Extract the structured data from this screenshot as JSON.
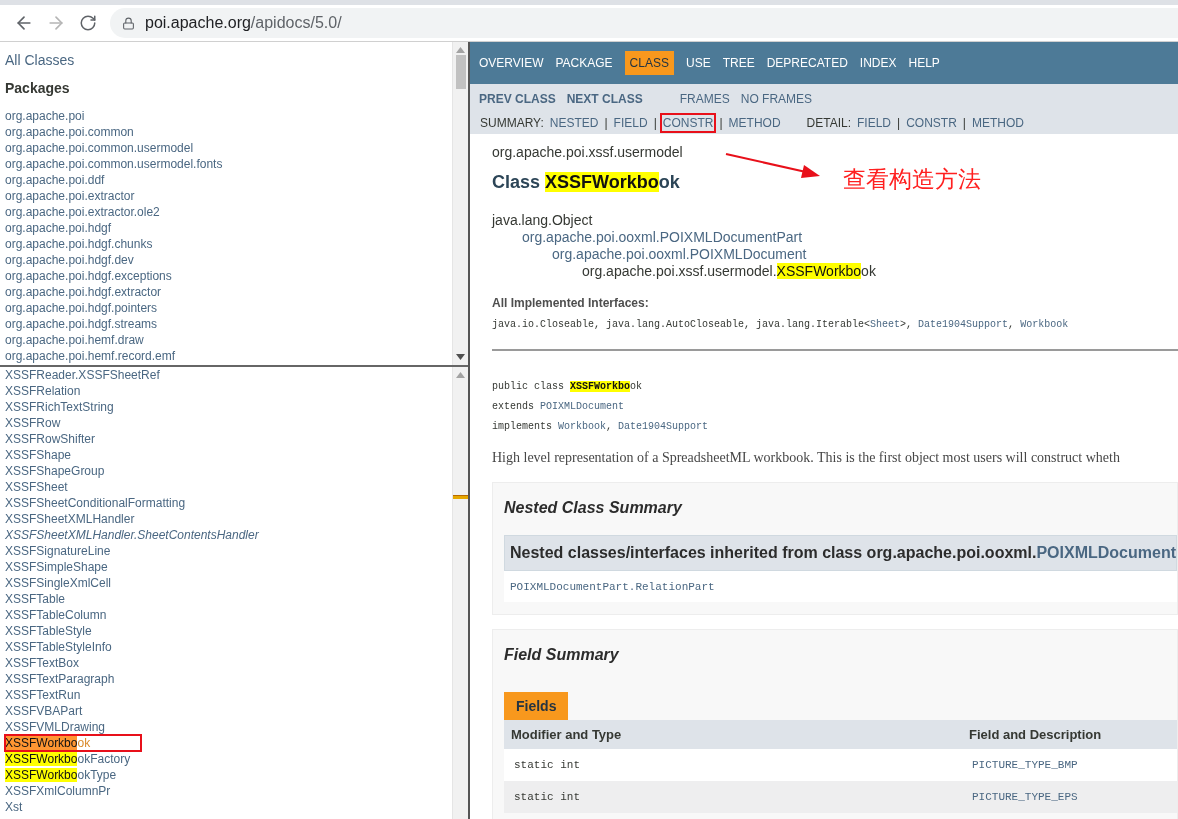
{
  "browser": {
    "url": {
      "host": "poi.apache.org",
      "path": "/apidocs/5.0/"
    }
  },
  "package_frame": {
    "all_classes_link": "All Classes",
    "heading": "Packages",
    "packages": [
      "org.apache.poi",
      "org.apache.poi.common",
      "org.apache.poi.common.usermodel",
      "org.apache.poi.common.usermodel.fonts",
      "org.apache.poi.ddf",
      "org.apache.poi.extractor",
      "org.apache.poi.extractor.ole2",
      "org.apache.poi.hdgf",
      "org.apache.poi.hdgf.chunks",
      "org.apache.poi.hdgf.dev",
      "org.apache.poi.hdgf.exceptions",
      "org.apache.poi.hdgf.extractor",
      "org.apache.poi.hdgf.pointers",
      "org.apache.poi.hdgf.streams",
      "org.apache.poi.hemf.draw",
      "org.apache.poi.hemf.record.emf"
    ]
  },
  "class_list": {
    "classes": [
      {
        "segments": [
          {
            "text": "XSSFReader.XSSFSheetRef",
            "kind": "text"
          }
        ],
        "italic": false,
        "annotated": false
      },
      {
        "segments": [
          {
            "text": "XSSFRelation",
            "kind": "text"
          }
        ],
        "italic": false,
        "annotated": false
      },
      {
        "segments": [
          {
            "text": "XSSFRichTextString",
            "kind": "text"
          }
        ],
        "italic": false,
        "annotated": false
      },
      {
        "segments": [
          {
            "text": "XSSFRow",
            "kind": "text"
          }
        ],
        "italic": false,
        "annotated": false
      },
      {
        "segments": [
          {
            "text": "XSSFRowShifter",
            "kind": "text"
          }
        ],
        "italic": false,
        "annotated": false
      },
      {
        "segments": [
          {
            "text": "XSSFShape",
            "kind": "text"
          }
        ],
        "italic": false,
        "annotated": false
      },
      {
        "segments": [
          {
            "text": "XSSFShapeGroup",
            "kind": "text"
          }
        ],
        "italic": false,
        "annotated": false
      },
      {
        "segments": [
          {
            "text": "XSSFSheet",
            "kind": "text"
          }
        ],
        "italic": false,
        "annotated": false
      },
      {
        "segments": [
          {
            "text": "XSSFSheetConditionalFormatting",
            "kind": "text"
          }
        ],
        "italic": false,
        "annotated": false
      },
      {
        "segments": [
          {
            "text": "XSSFSheetXMLHandler",
            "kind": "text"
          }
        ],
        "italic": false,
        "annotated": false
      },
      {
        "segments": [
          {
            "text": "XSSFSheetXMLHandler.SheetContentsHandler",
            "kind": "text"
          }
        ],
        "italic": true,
        "annotated": false
      },
      {
        "segments": [
          {
            "text": "XSSFSignatureLine",
            "kind": "text"
          }
        ],
        "italic": false,
        "annotated": false
      },
      {
        "segments": [
          {
            "text": "XSSFSimpleShape",
            "kind": "text"
          }
        ],
        "italic": false,
        "annotated": false
      },
      {
        "segments": [
          {
            "text": "XSSFSingleXmlCell",
            "kind": "text"
          }
        ],
        "italic": false,
        "annotated": false
      },
      {
        "segments": [
          {
            "text": "XSSFTable",
            "kind": "text"
          }
        ],
        "italic": false,
        "annotated": false
      },
      {
        "segments": [
          {
            "text": "XSSFTableColumn",
            "kind": "text"
          }
        ],
        "italic": false,
        "annotated": false
      },
      {
        "segments": [
          {
            "text": "XSSFTableStyle",
            "kind": "text"
          }
        ],
        "italic": false,
        "annotated": false
      },
      {
        "segments": [
          {
            "text": "XSSFTableStyleInfo",
            "kind": "text"
          }
        ],
        "italic": false,
        "annotated": false
      },
      {
        "segments": [
          {
            "text": "XSSFTextBox",
            "kind": "text"
          }
        ],
        "italic": false,
        "annotated": false
      },
      {
        "segments": [
          {
            "text": "XSSFTextParagraph",
            "kind": "text"
          }
        ],
        "italic": false,
        "annotated": false
      },
      {
        "segments": [
          {
            "text": "XSSFTextRun",
            "kind": "text"
          }
        ],
        "italic": false,
        "annotated": false
      },
      {
        "segments": [
          {
            "text": "XSSFVBAPart",
            "kind": "text"
          }
        ],
        "italic": false,
        "annotated": false
      },
      {
        "segments": [
          {
            "text": "XSSFVMLDrawing",
            "kind": "text"
          }
        ],
        "italic": false,
        "annotated": false
      },
      {
        "segments": [
          {
            "text": "XSSFWorkbo",
            "kind": "match_current"
          },
          {
            "text": "ok",
            "kind": "current_rest"
          }
        ],
        "italic": false,
        "annotated": true
      },
      {
        "segments": [
          {
            "text": "XSSFWorkbo",
            "kind": "match"
          },
          {
            "text": "okFactory",
            "kind": "text"
          }
        ],
        "italic": false,
        "annotated": false
      },
      {
        "segments": [
          {
            "text": "XSSFWorkbo",
            "kind": "match"
          },
          {
            "text": "okType",
            "kind": "text"
          }
        ],
        "italic": false,
        "annotated": false
      },
      {
        "segments": [
          {
            "text": "XSSFXmlColumnPr",
            "kind": "text"
          }
        ],
        "italic": false,
        "annotated": false
      },
      {
        "segments": [
          {
            "text": "Xst",
            "kind": "text"
          }
        ],
        "italic": false,
        "annotated": false
      }
    ]
  },
  "nav": {
    "tabs": [
      {
        "label": "OVERVIEW",
        "selected": false
      },
      {
        "label": "PACKAGE",
        "selected": false
      },
      {
        "label": "CLASS",
        "selected": true
      },
      {
        "label": "USE",
        "selected": false
      },
      {
        "label": "TREE",
        "selected": false
      },
      {
        "label": "DEPRECATED",
        "selected": false
      },
      {
        "label": "INDEX",
        "selected": false
      },
      {
        "label": "HELP",
        "selected": false
      }
    ]
  },
  "subnav": {
    "class_links": [
      "PREV CLASS",
      "NEXT CLASS"
    ],
    "frame_links": [
      "FRAMES",
      "NO FRAMES"
    ],
    "summary": [
      {
        "text": "SUMMARY:",
        "kind": "text",
        "annotated": false
      },
      {
        "text": "NESTED",
        "kind": "link",
        "annotated": false
      },
      {
        "text": "|",
        "kind": "text",
        "annotated": false
      },
      {
        "text": "FIELD",
        "kind": "link",
        "annotated": false
      },
      {
        "text": "|",
        "kind": "text",
        "annotated": false
      },
      {
        "text": "CONSTR",
        "kind": "link",
        "annotated": true
      },
      {
        "text": "|",
        "kind": "text",
        "annotated": false
      },
      {
        "text": "METHOD",
        "kind": "link",
        "annotated": false
      }
    ],
    "detail": [
      {
        "text": "DETAIL:",
        "kind": "text",
        "annotated": false
      },
      {
        "text": "FIELD",
        "kind": "link",
        "annotated": false
      },
      {
        "text": "|",
        "kind": "text",
        "annotated": false
      },
      {
        "text": "CONSTR",
        "kind": "link",
        "annotated": false
      },
      {
        "text": "|",
        "kind": "text",
        "annotated": false
      },
      {
        "text": "METHOD",
        "kind": "link",
        "annotated": false
      }
    ]
  },
  "content": {
    "package_name": "org.apache.poi.xssf.usermodel",
    "title": [
      {
        "text": "Class ",
        "kind": "text"
      },
      {
        "text": "XSSFWorkbo",
        "kind": "match"
      },
      {
        "text": "ok",
        "kind": "text"
      }
    ],
    "inheritance": {
      "segments": [
        {
          "text": "java.lang.Object",
          "kind": "text"
        }
      ],
      "children": [
        {
          "segments": [
            {
              "text": "org.apache.poi.ooxml.POIXMLDocumentPart",
              "kind": "link"
            }
          ],
          "children": [
            {
              "segments": [
                {
                  "text": "org.apache.poi.ooxml.POIXMLDocument",
                  "kind": "link"
                }
              ],
              "children": [
                {
                  "segments": [
                    {
                      "text": "org.apache.poi.xssf.usermodel.",
                      "kind": "text"
                    },
                    {
                      "text": "XSSFWorkbo",
                      "kind": "match"
                    },
                    {
                      "text": "ok",
                      "kind": "text"
                    }
                  ]
                }
              ]
            }
          ]
        }
      ]
    },
    "interfaces": {
      "heading": "All Implemented Interfaces:",
      "segments": [
        {
          "text": "java.io.Closeable, java.lang.AutoCloseable, java.lang.Iterable<",
          "kind": "text"
        },
        {
          "text": "Sheet",
          "kind": "link"
        },
        {
          "text": ">, ",
          "kind": "text"
        },
        {
          "text": "Date1904Support",
          "kind": "link"
        },
        {
          "text": ", ",
          "kind": "text"
        },
        {
          "text": "Workbook",
          "kind": "link"
        }
      ]
    },
    "declaration": [
      {
        "segments": [
          {
            "text": "public class ",
            "kind": "text"
          },
          {
            "text": "XSSFWorkbo",
            "kind": "match_bold"
          },
          {
            "text": "ok",
            "kind": "text"
          }
        ]
      },
      {
        "segments": [
          {
            "text": "extends ",
            "kind": "text"
          },
          {
            "text": "POIXMLDocument",
            "kind": "link"
          }
        ]
      },
      {
        "segments": [
          {
            "text": "implements ",
            "kind": "text"
          },
          {
            "text": "Workbook",
            "kind": "link"
          },
          {
            "text": ", ",
            "kind": "text"
          },
          {
            "text": "Date1904Support",
            "kind": "link"
          }
        ]
      }
    ],
    "description": "High level representation of a SpreadsheetML workbook. This is the first object most users will construct wheth",
    "nested_summary": {
      "title": "Nested Class Summary",
      "inherited_header": [
        {
          "text": "Nested classes/interfaces inherited from class org.apache.poi.ooxml.",
          "kind": "text"
        },
        {
          "text": "POIXMLDocument",
          "kind": "link"
        }
      ],
      "items": [
        "POIXMLDocumentPart.RelationPart"
      ]
    },
    "field_summary": {
      "title": "Field Summary",
      "tabs": [
        {
          "label": "Fields",
          "selected": true
        }
      ],
      "columns": [
        "Modifier and Type",
        "Field and Description"
      ],
      "rows": [
        [
          "static int",
          "PICTURE_TYPE_BMP"
        ],
        [
          "static int",
          "PICTURE_TYPE_EPS"
        ]
      ]
    }
  },
  "annotation": {
    "text": "查看构造方法"
  }
}
